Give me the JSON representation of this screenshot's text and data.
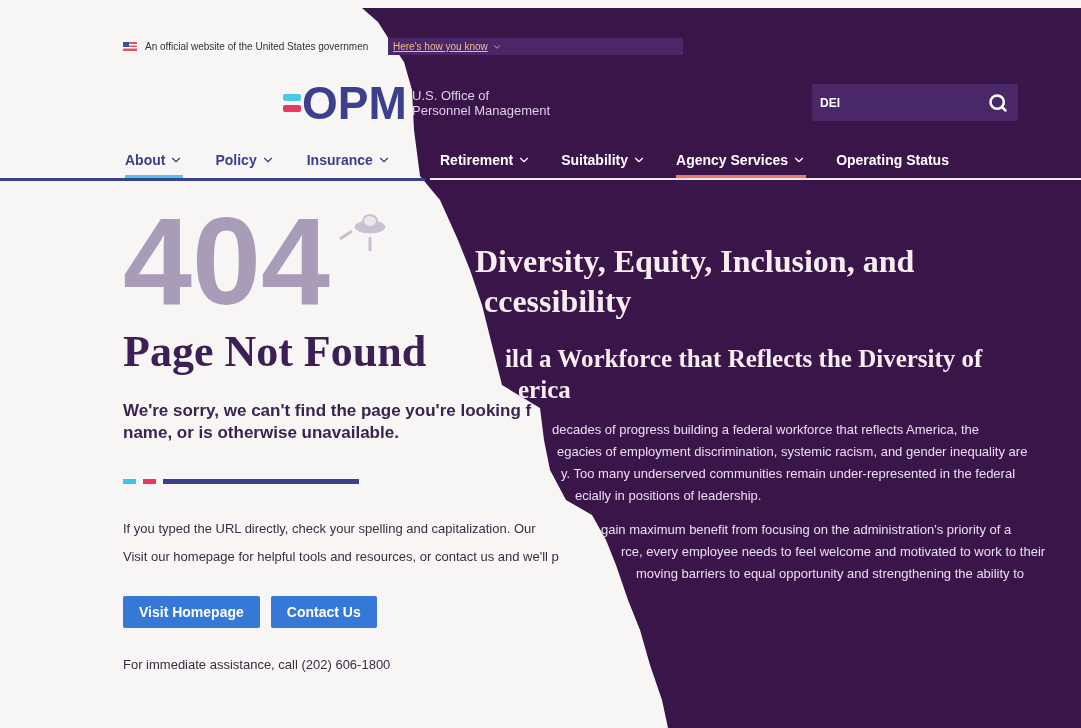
{
  "left_page": {
    "gov_banner": {
      "text": "An official website of the United States governmen"
    },
    "logo": {
      "text": "OPM"
    },
    "nav": [
      {
        "label": "About",
        "selected": true,
        "dropdown": true
      },
      {
        "label": "Policy",
        "selected": false,
        "dropdown": true
      },
      {
        "label": "Insurance",
        "selected": false,
        "dropdown": true
      }
    ],
    "error_code": "404",
    "title": "Page Not Found",
    "lead_lines": [
      "We're sorry, we can't find the page you're looking f",
      "name, or is otherwise unavailable."
    ],
    "paragraphs": [
      "If you typed the URL directly, check your spelling and capitalization. Our",
      "Visit our homepage for helpful tools and resources, or contact us and we'll p"
    ],
    "buttons": [
      "Visit Homepage",
      "Contact Us"
    ],
    "footer_note": "For immediate assistance, call (202) 606-1800"
  },
  "right_page": {
    "gov_banner_link": "Here's how you know",
    "agency_name": [
      "U.S. Office of",
      "Personnel Management"
    ],
    "search": {
      "value": "DEI"
    },
    "nav": [
      {
        "label": "Retirement",
        "selected": false,
        "dropdown": true
      },
      {
        "label": "Suitability",
        "selected": false,
        "dropdown": true
      },
      {
        "label": "Agency Services",
        "selected": true,
        "dropdown": true
      },
      {
        "label": "Operating Status",
        "selected": false,
        "dropdown": false
      }
    ],
    "title_lines": [
      "Diversity, Equity, Inclusion, and",
      "ccessibility"
    ],
    "subtitle_lines": [
      "ild a Workforce that Reflects the Diversity of",
      "erica"
    ],
    "body_lines": [
      "decades of progress building a federal workforce that reflects America, the",
      "egacies of employment discrimination, systemic racism, and gender inequality are",
      "y. Too many underserved communities remain under-represented in the federal",
      "ecially in positions of leadership."
    ],
    "body2_lines": [
      "gain maximum benefit from focusing on the administration’s priority of a",
      "rce, every employee needs to feel welcome and motivated to work to their",
      "moving barriers to equal opportunity and strengthening the ability to"
    ]
  }
}
